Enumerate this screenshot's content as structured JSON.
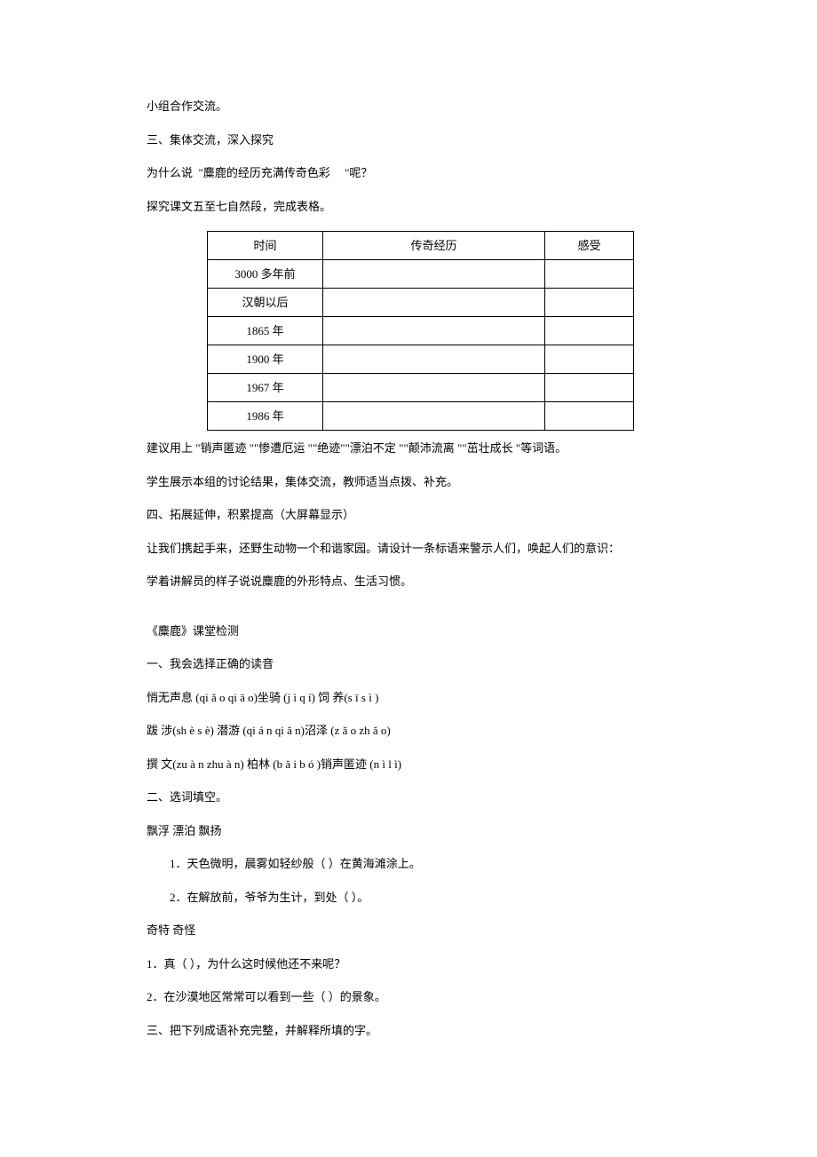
{
  "p1": "小组合作交流。",
  "p2": "三、集体交流，深入探究",
  "p3_a": "为什么说",
  "p3_b": "麋鹿的经历充满传奇色彩",
  "p3_c": "\"呢？",
  "p4": "探究课文五至七自然段，完成表格。",
  "table": {
    "header": {
      "c1": "时间",
      "c2": "传奇经历",
      "c3": "感受"
    },
    "rows": [
      {
        "c1": "3000 多年前",
        "c2": "",
        "c3": ""
      },
      {
        "c1": "汉朝以后",
        "c2": "",
        "c3": ""
      },
      {
        "c1": "1865 年",
        "c2": "",
        "c3": ""
      },
      {
        "c1": "1900 年",
        "c2": "",
        "c3": ""
      },
      {
        "c1": "1967 年",
        "c2": "",
        "c3": ""
      },
      {
        "c1": "1986 年",
        "c2": "",
        "c3": ""
      }
    ]
  },
  "p5": "建议用上 \"销声匿迹 \"\"惨遭厄运 \"\"绝迹\"\"漂泊不定 \"\"颠沛流离 \"\"茁壮成长 \"等词语。",
  "p6": "学生展示本组的讨论结果，集体交流，教师适当点拨、补充。",
  "p7": "四、拓展延伸，积累提高（大屏幕显示）",
  "p8": "让我们携起手来，还野生动物一个和谐家园。请设计一条标语来警示人们，唤起人们的意识：",
  "p9": "学着讲解员的样子说说麋鹿的外形特点、生活习惯。",
  "p10": "《麋鹿》课堂检测",
  "p11": "一、我会选择正确的读音",
  "p12": "悄无声息 (qi ǎ o qi ā o)坐骑 (j ì q í)  饲 养(s ī  s ì )",
  "p13": "跋 涉(sh è s è)  潜游 (qi á n qi ǎ n)沼泽 (z ǎ o zh ǎ o)",
  "p14": "撰   文(zu à n zhu à n)   柏林 (b ǎ i b ó )销声匿迹 (n ì l ì)",
  "p15": "二、选词填空。",
  "p16": "飘浮    漂泊     飘扬",
  "p17": "1．天色微明，晨雾如轻纱般（            ）在黄海滩涂上。",
  "p18": "2．在解放前，爷爷为生计，到处（            ）。",
  "p19": "奇特     奇怪",
  "p20": "1．真（        ），为什么这时候他还不来呢？",
  "p21": "2．在沙漠地区常常可以看到一些（            ）的景象。",
  "p22": "三、把下列成语补充完整，并解释所填的字。"
}
